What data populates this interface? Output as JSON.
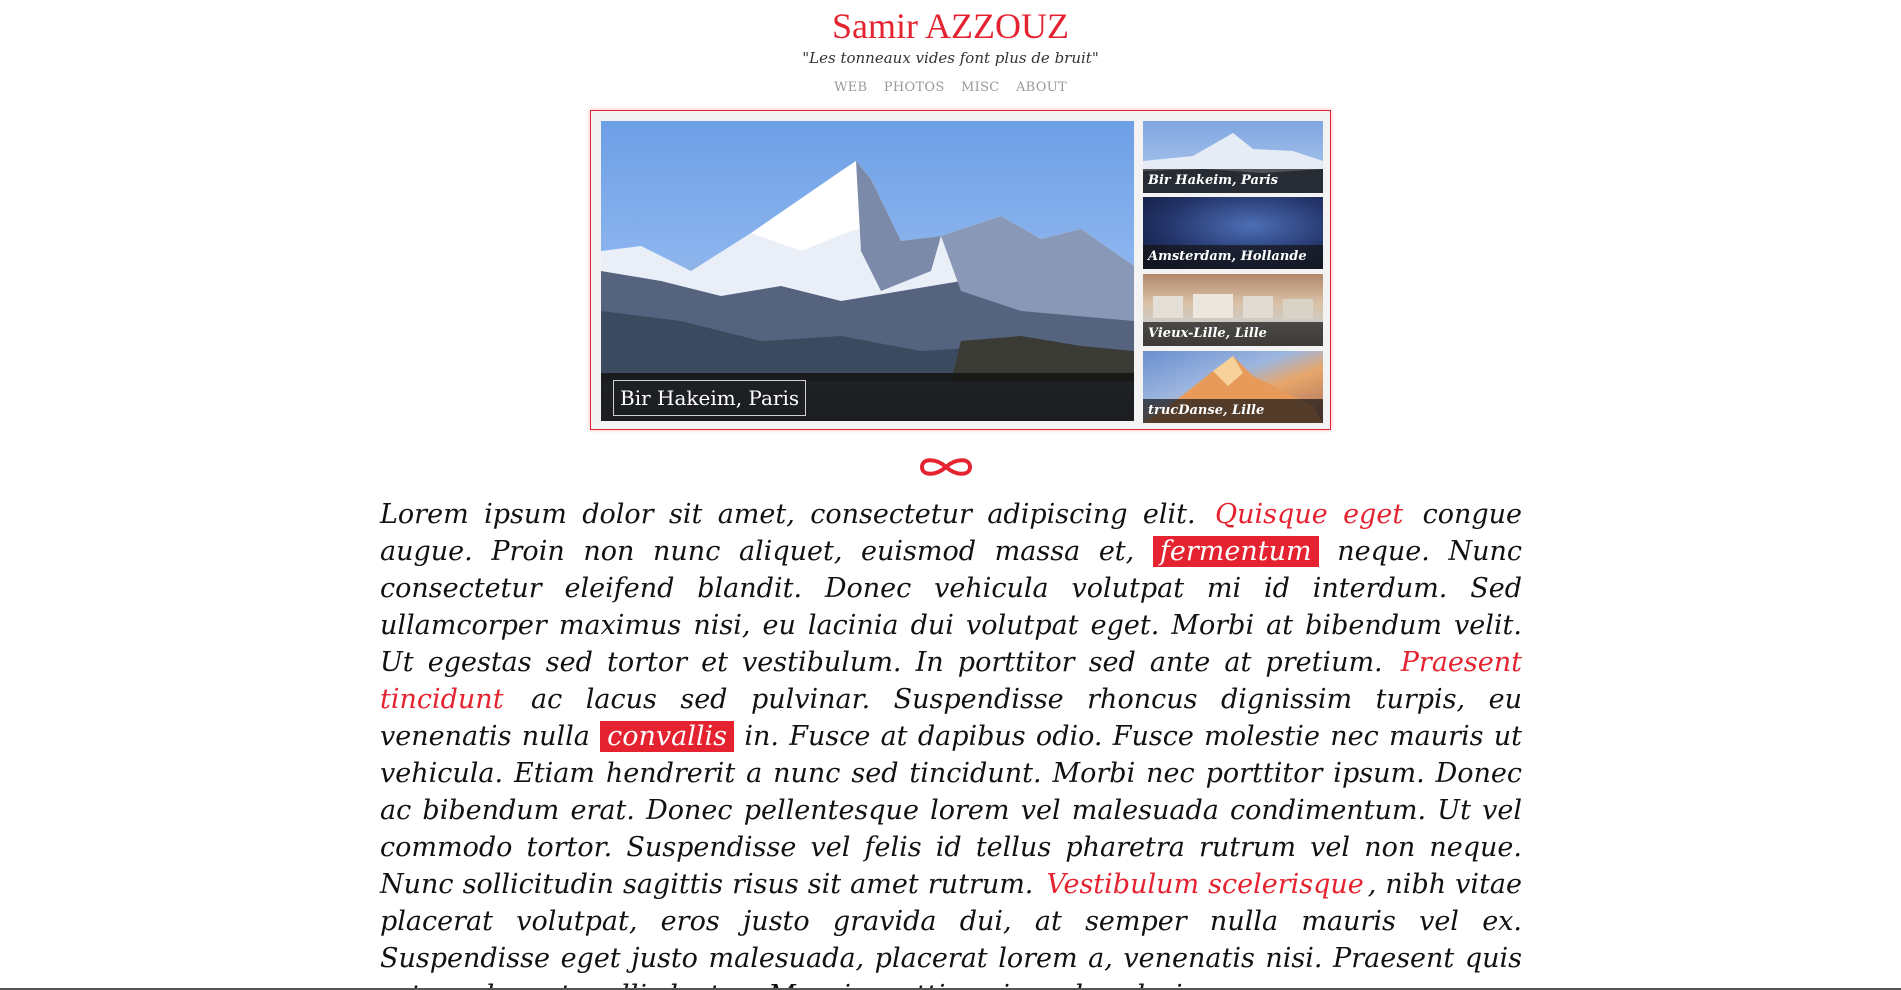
{
  "site": {
    "title": "Samir AZZOUZ",
    "tagline": "\"Les tonneaux vides font plus de bruit\""
  },
  "nav": {
    "items": [
      "WEB",
      "PHOTOS",
      "MISC",
      "ABOUT"
    ]
  },
  "gallery": {
    "main_caption": "Bir Hakeim, Paris",
    "thumbnails": [
      "Bir Hakeim, Paris",
      "Amsterdam, Hollande",
      "Vieux-Lille, Lille",
      "trucDanse, Lille"
    ]
  },
  "article": {
    "segments": [
      {
        "type": "text",
        "text": "Lorem ipsum dolor sit amet, consectetur adipiscing elit. "
      },
      {
        "type": "link",
        "text": "Quisque eget"
      },
      {
        "type": "text",
        "text": " congue augue. Proin non nunc aliquet, euismod massa et, "
      },
      {
        "type": "highlight",
        "text": "fermentum"
      },
      {
        "type": "text",
        "text": " neque. Nunc consectetur eleifend blandit. Donec vehicula volutpat mi id interdum. Sed ullamcorper maximus nisi, eu lacinia dui volutpat eget. Morbi at bibendum velit. Ut egestas sed tortor et vestibulum. In porttitor sed ante at pretium. "
      },
      {
        "type": "link",
        "text": "Praesent tincidunt"
      },
      {
        "type": "text",
        "text": " ac lacus sed pulvinar. Suspendisse rhoncus dignissim turpis, eu venenatis nulla "
      },
      {
        "type": "highlight",
        "text": "convallis"
      },
      {
        "type": "text",
        "text": " in. Fusce at dapibus odio. Fusce molestie nec mauris ut vehicula. Etiam hendrerit a nunc sed tincidunt. Morbi nec porttitor ipsum. Donec ac bibendum erat. Donec pellentesque lorem vel malesuada condimentum. Ut vel commodo tortor. Suspendisse vel felis id tellus pharetra rutrum vel non neque. Nunc sollicitudin sagittis risus sit amet rutrum. "
      },
      {
        "type": "link",
        "text": "Vestibulum scelerisque"
      },
      {
        "type": "text",
        "text": ", nibh vitae placerat volutpat, eros justo gravida dui, at semper nulla mauris vel ex. Suspendisse eget justo malesuada, placerat lorem a, venenatis nisi. Praesent quis rutrum leo, et mollis lectus. Mauris mattis euismod scelerisque."
      }
    ]
  },
  "colors": {
    "accent": "#e52330",
    "text": "#111111",
    "nav": "#999999"
  },
  "icons": {
    "divider": "infinity-ornament-icon"
  }
}
